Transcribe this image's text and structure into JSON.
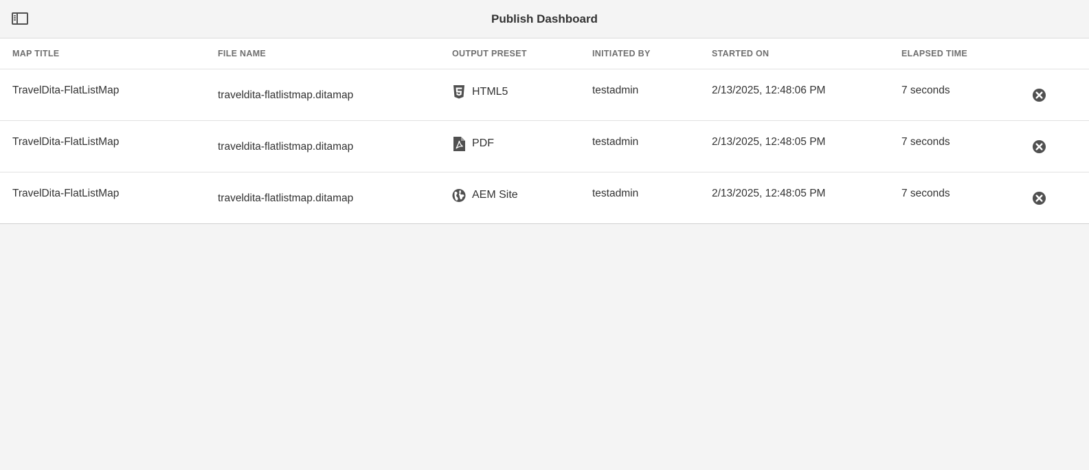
{
  "header": {
    "title": "Publish Dashboard",
    "rail_toggle_icon": "rail-toggle-icon"
  },
  "table": {
    "columns": [
      "MAP TITLE",
      "FILE NAME",
      "OUTPUT PRESET",
      "INITIATED BY",
      "STARTED ON",
      "ELAPSED TIME"
    ],
    "rows": [
      {
        "map_title": "TravelDita-FlatListMap",
        "file_name": "traveldita-flatlistmap.ditamap",
        "preset_icon": "html5-icon",
        "output_preset": "HTML5",
        "initiated_by": "testadmin",
        "started_on": "2/13/2025, 12:48:06 PM",
        "elapsed_time": "7 seconds",
        "action_icon": "cancel-icon"
      },
      {
        "map_title": "TravelDita-FlatListMap",
        "file_name": "traveldita-flatlistmap.ditamap",
        "preset_icon": "pdf-icon",
        "output_preset": "PDF",
        "initiated_by": "testadmin",
        "started_on": "2/13/2025, 12:48:05 PM",
        "elapsed_time": "7 seconds",
        "action_icon": "cancel-icon"
      },
      {
        "map_title": "TravelDita-FlatListMap",
        "file_name": "traveldita-flatlistmap.ditamap",
        "preset_icon": "globe-icon",
        "output_preset": "AEM Site",
        "initiated_by": "testadmin",
        "started_on": "2/13/2025, 12:48:05 PM",
        "elapsed_time": "7 seconds",
        "action_icon": "cancel-icon"
      }
    ]
  },
  "colors": {
    "background": "#f4f4f4",
    "table_background": "#ffffff",
    "text": "#323232",
    "header_text": "#6e6e6e",
    "icon": "#505050"
  }
}
